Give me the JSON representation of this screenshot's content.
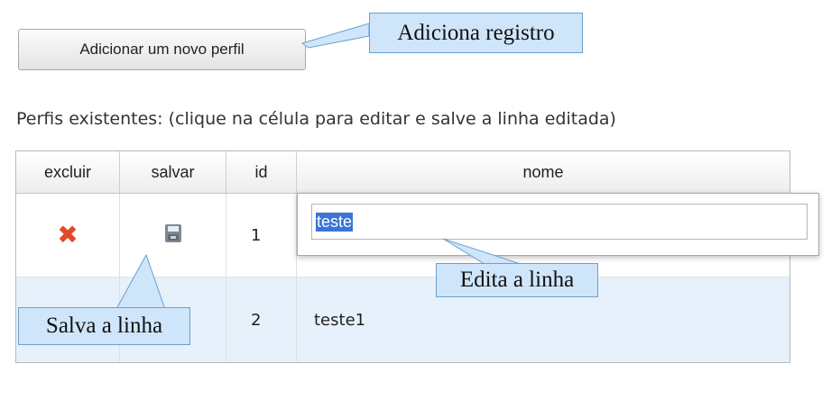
{
  "toolbar": {
    "add_label": "Adicionar um novo perfil"
  },
  "intro_text": "Perfis existentes: (clique na célula para editar e salve a linha editada)",
  "grid": {
    "columns": [
      "excluir",
      "salvar",
      "id",
      "nome"
    ],
    "rows": [
      {
        "id": "1",
        "nome": ""
      },
      {
        "id": "2",
        "nome": "teste1"
      }
    ],
    "editor_value": "teste"
  },
  "callouts": {
    "add": "Adiciona registro",
    "edit": "Edita a linha",
    "save": "Salva a linha"
  },
  "icons": {
    "delete": "delete-x-icon",
    "save": "floppy-disk-icon"
  },
  "colors": {
    "delete_icon": "#e2492a",
    "selected_row": "#e7f1fb",
    "callout_fill": "#cfe5fa",
    "selection": "#3a74d9"
  }
}
